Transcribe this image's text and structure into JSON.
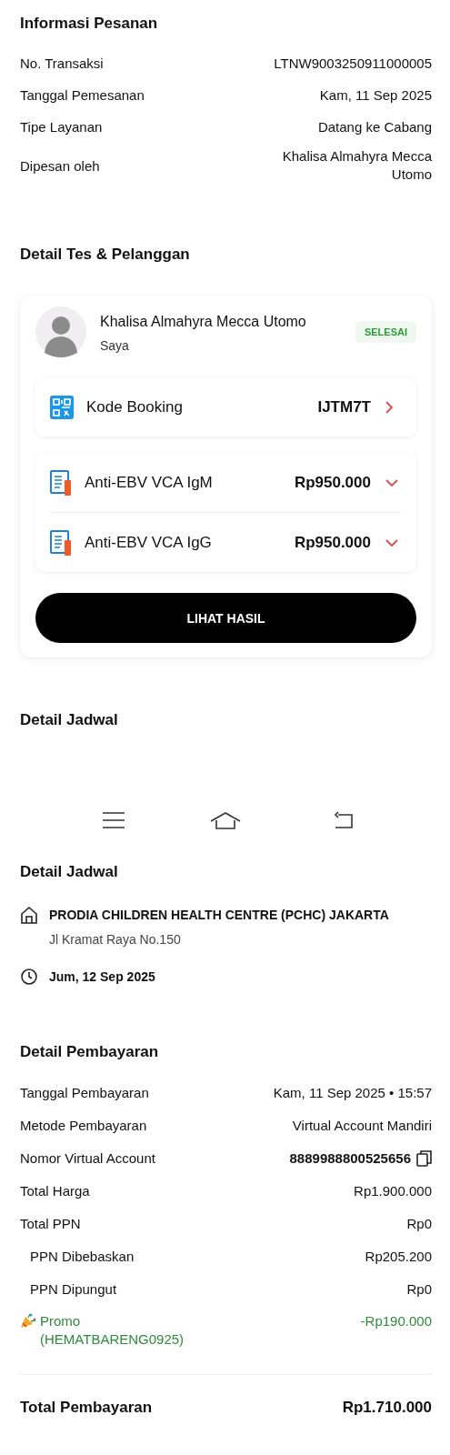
{
  "order_info": {
    "title": "Informasi Pesanan",
    "rows": [
      {
        "label": "No. Transaksi",
        "value": "LTNW9003250911000005"
      },
      {
        "label": "Tanggal Pemesanan",
        "value": "Kam, 11 Sep 2025"
      },
      {
        "label": "Tipe Layanan",
        "value": "Datang ke Cabang"
      },
      {
        "label": "Dipesan oleh",
        "value": "Khalisa Almahyra Mecca Utomo"
      }
    ]
  },
  "test_detail": {
    "title": "Detail Tes & Pelanggan",
    "customer": {
      "name": "Khalisa Almahyra Mecca Utomo",
      "relation": "Saya",
      "status": "SELESAI"
    },
    "booking": {
      "label": "Kode Booking",
      "code": "IJTM7T"
    },
    "tests": [
      {
        "name": "Anti-EBV VCA IgM",
        "price": "Rp950.000",
        "expanded": false
      },
      {
        "name": "Anti-EBV VCA IgG",
        "price": "Rp950.000",
        "expanded": false
      }
    ],
    "button": "LIHAT HASIL"
  },
  "schedule_preview": {
    "title": "Detail Jadwal"
  },
  "schedule": {
    "title": "Detail Jadwal",
    "location": "PRODIA CHILDREN HEALTH CENTRE (PCHC) JAKARTA",
    "address": "Jl Kramat Raya No.150",
    "date": "Jum, 12 Sep 2025"
  },
  "payment": {
    "title": "Detail Pembayaran",
    "rows": [
      {
        "kind": "plain",
        "label": "Tanggal Pembayaran",
        "value": "Kam, 11 Sep 2025 • 15:57"
      },
      {
        "kind": "plain",
        "label": "Metode Pembayaran",
        "value": "Virtual Account Mandiri"
      },
      {
        "kind": "copy",
        "label": "Nomor Virtual Account",
        "value": "8889988800525656"
      },
      {
        "kind": "plain",
        "label": "Total Harga",
        "value": "Rp1.900.000"
      },
      {
        "kind": "plain",
        "label": "Total PPN",
        "value": "Rp0"
      },
      {
        "kind": "sub",
        "label": "PPN Dibebaskan",
        "value": "Rp205.200"
      },
      {
        "kind": "sub",
        "label": "PPN Dipungut",
        "value": "Rp0"
      },
      {
        "kind": "promo",
        "label": "Promo (HEMATBARENG0925)",
        "value": "-Rp190.000"
      }
    ],
    "total": {
      "label": "Total Pembayaran",
      "value": "Rp1.710.000"
    }
  }
}
